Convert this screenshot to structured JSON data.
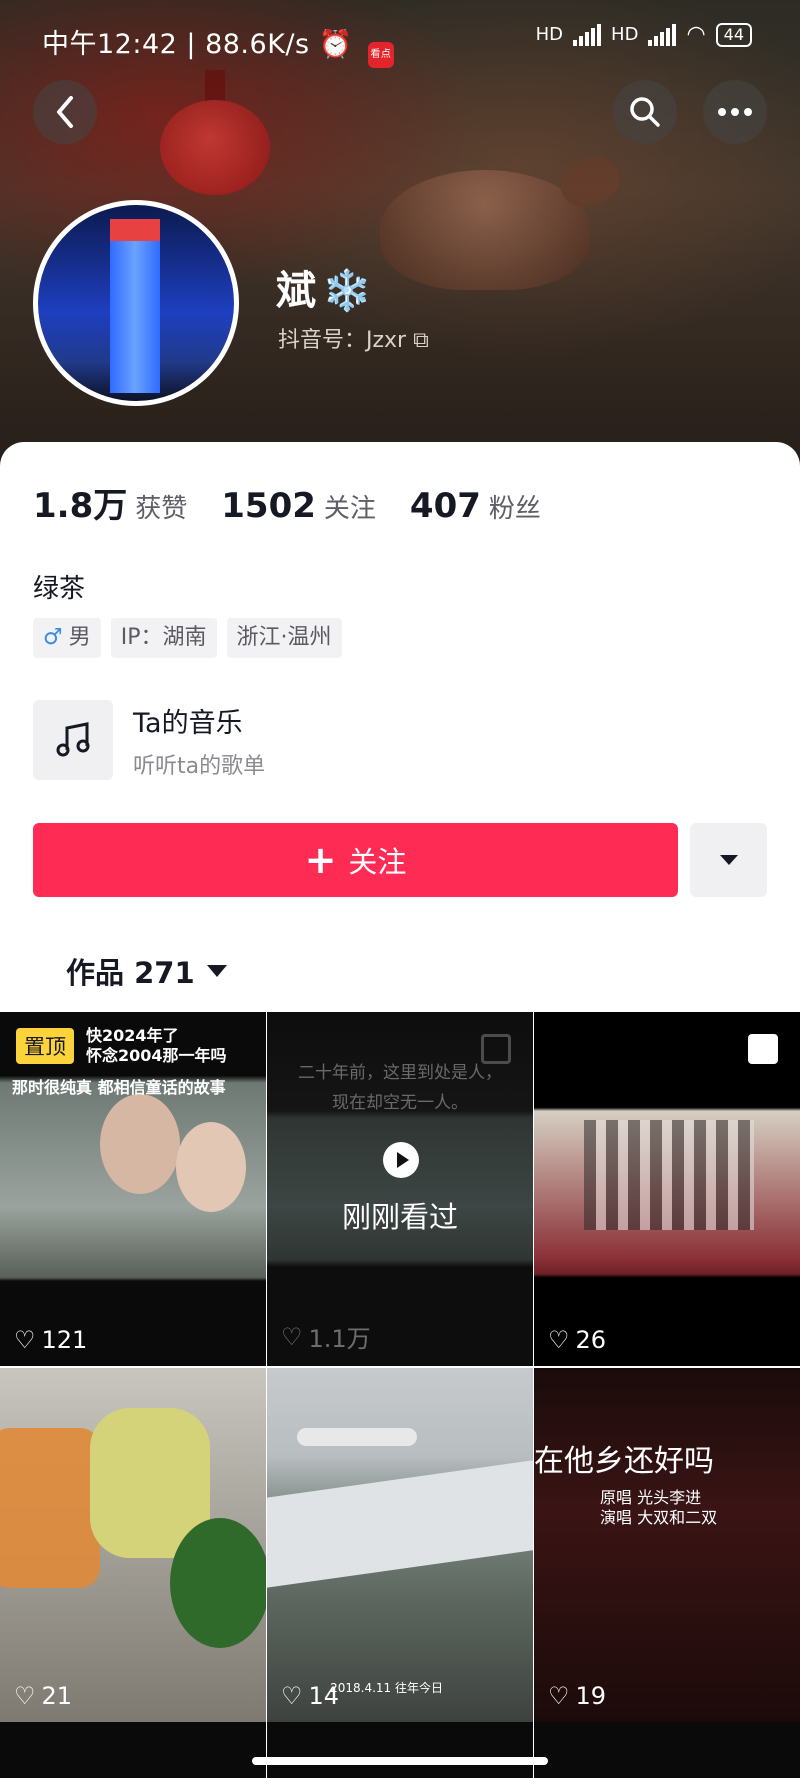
{
  "status_bar": {
    "time_speed": "中午12:42 | 88.6K/s",
    "app_badge": "看点",
    "net1": "HD",
    "net2": "HD",
    "battery": "44"
  },
  "profile": {
    "nickname": "斌",
    "nickname_emoji": "❄️",
    "douyin_id": "抖音号：Jzxr",
    "stats": [
      {
        "num": "1.8万",
        "label": "获赞"
      },
      {
        "num": "1502",
        "label": "关注"
      },
      {
        "num": "407",
        "label": "粉丝"
      }
    ],
    "bio": "绿茶",
    "tags": [
      {
        "icon": "♂",
        "text": "男"
      },
      {
        "text": "IP：湖南"
      },
      {
        "text": "浙江·温州"
      }
    ],
    "music": {
      "title": "Ta的音乐",
      "subtitle": "听听ta的歌单"
    },
    "follow_label": "关注"
  },
  "works": {
    "label": "作品 271"
  },
  "posts": [
    {
      "likes": "121",
      "pinned": "置顶",
      "caption": "快2024年了\n怀念2004那一年吗",
      "caption2": "那时很纯真 都相信童话的故事"
    },
    {
      "likes": "1.1万",
      "caption": "二十年前，这里到处是人，\n现在却空无一人。",
      "recent_label": "刚刚看过"
    },
    {
      "likes": "26"
    },
    {
      "likes": "21"
    },
    {
      "likes": "14",
      "date": "2018.4.11 往年今日"
    },
    {
      "likes": "19",
      "caption": "在他乡还好吗",
      "caption2": "原唱  光头李进\n演唱  大双和二双"
    }
  ],
  "colors": {
    "accent": "#fe2c55",
    "pin_badge": "#fdd33b"
  }
}
